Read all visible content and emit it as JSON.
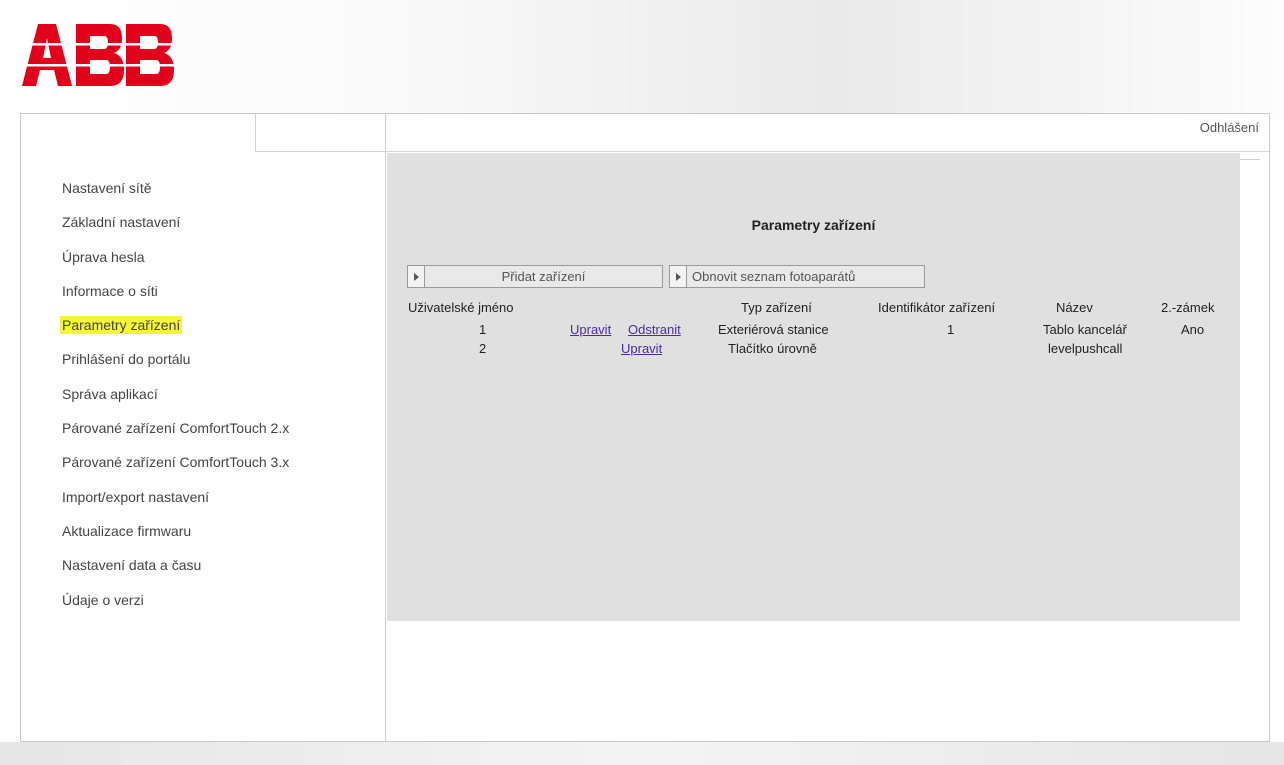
{
  "brand": {
    "logo_text": "ABB",
    "logo_color": "#e2001a"
  },
  "header": {
    "logout": "Odhlášení"
  },
  "sidebar": {
    "items": [
      {
        "label": "Nastavení sítě"
      },
      {
        "label": "Základní nastavení"
      },
      {
        "label": "Úprava hesla"
      },
      {
        "label": "Informace o síti"
      },
      {
        "label": "Parametry zařízení",
        "highlighted": true
      },
      {
        "label": "Prihlášení do portálu"
      },
      {
        "label": "Správa aplikací"
      },
      {
        "label": "Párované zařízení ComfortTouch 2.x"
      },
      {
        "label": "Párované zařízení ComfortTouch 3.x"
      },
      {
        "label": "Import/export nastavení"
      },
      {
        "label": "Aktualizace firmwaru"
      },
      {
        "label": "Nastavení data a času"
      },
      {
        "label": "Údaje o verzi"
      }
    ],
    "highlight_color": "#f5f53a"
  },
  "main": {
    "title": "Parametry zařízení",
    "buttons": {
      "add_device": "Přidat zařízení",
      "refresh_cameras": "Obnovit seznam fotoaparátů"
    },
    "table": {
      "headers": {
        "username": "Uživatelské jméno",
        "device_type": "Typ zařízení",
        "device_id": "Identifikátor zařízení",
        "name": "Název",
        "second_lock": "2.-zámek"
      },
      "rows": [
        {
          "username": "1",
          "edit": "Upravit",
          "remove": "Odstranit",
          "device_type": "Exteriérová stanice",
          "device_id": "1",
          "name": "Tablo kancelář",
          "second_lock": "Ano"
        },
        {
          "username": "2",
          "edit": "Upravit",
          "remove": "",
          "device_type": "Tlačítko úrovně",
          "device_id": "",
          "name": "levelpushcall",
          "second_lock": ""
        }
      ]
    },
    "link_color": "#4b2c9a",
    "content_bg": "#e0e0e0"
  }
}
